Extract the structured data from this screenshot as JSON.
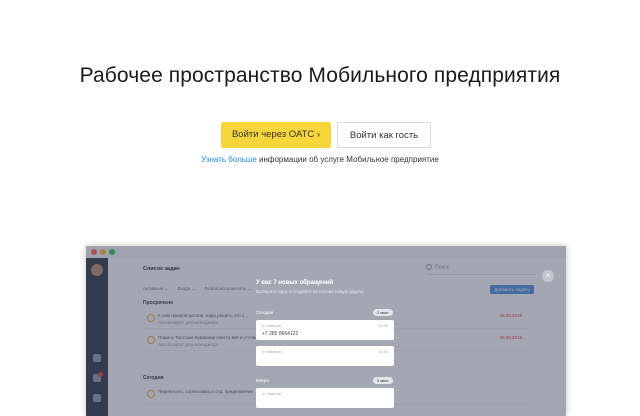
{
  "page": {
    "title": "Рабочее пространство Мобильного предприятия",
    "primary_button": "Войти через ОАТС ›",
    "secondary_button": "Войти как гость",
    "learn_link": "Узнать больше",
    "learn_rest": " информации об услуге Мобильное предприятие"
  },
  "preview": {
    "app_title": "Список задач",
    "search_placeholder": "Поиск",
    "filters": [
      "Активные ⌄",
      "Входя ⌄",
      "Любой исполнитель ⌄"
    ],
    "add_button": "Добавить задачу",
    "section_overdue": "Просрочено",
    "section_today": "Сегодня",
    "rows": [
      {
        "text": "К нам пришли детали, надо решить что с...",
        "sub": "Автовозврат для менеджера",
        "date": "05.09.2016"
      },
      {
        "text": "Помочь Толстым Компании свести всё и уточнить детали перед выполнением заказа...",
        "sub": "Автовозврат для менеджера",
        "date": "05.09.2016"
      },
      {
        "text": "Переписать, согласовать с отд. предложение",
        "sub": "",
        "date": ""
      }
    ],
    "overlay": {
      "title": "У вас 7 новых обращений",
      "subtitle": "Выберите одну и создайте на основе новую задачу",
      "groups": [
        {
          "label": "Сегодня",
          "count": "3 звон."
        },
        {
          "label": "Вчера",
          "count": "3 звон."
        }
      ],
      "cards": [
        {
          "from": "от Иванов",
          "number": "+7 285 8664122",
          "time": "11:45"
        },
        {
          "from": "от Иванов",
          "number": "",
          "time": "11:45"
        }
      ],
      "close": "×"
    }
  }
}
